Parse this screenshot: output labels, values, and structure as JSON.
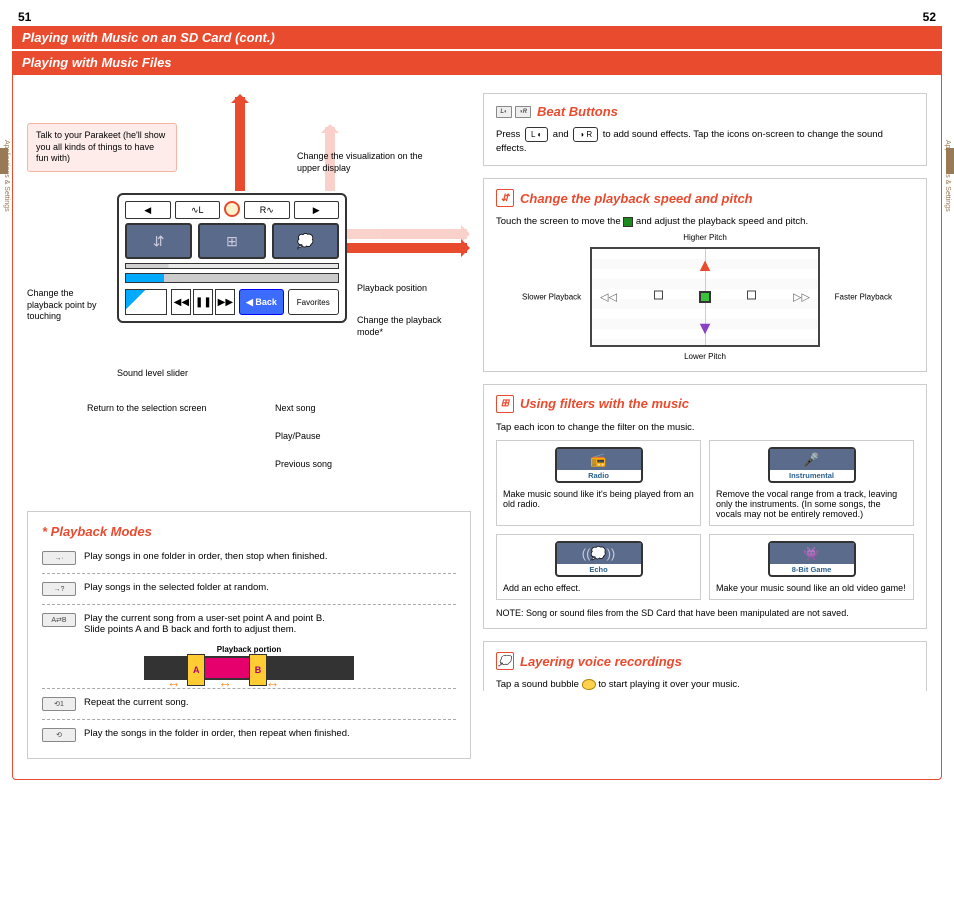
{
  "page_left": "51",
  "page_right": "52",
  "side_tab": "Applications & Settings",
  "header_main": "Playing with Music on an SD Card (cont.)",
  "header_sub": "Playing with Music Files",
  "parakeet_tip": "Talk to your Parakeet (he'll show you all kinds of things to have fun with)",
  "callouts": {
    "change_viz": "Change the visualization on the upper display",
    "playback_pos": "Playback position",
    "change_mode": "Change the playback mode*",
    "change_point": "Change the playback point by touching",
    "sound_slider": "Sound level slider",
    "return_sel": "Return to the selection screen",
    "next": "Next song",
    "playpause": "Play/Pause",
    "prev": "Previous song"
  },
  "device": {
    "l_btn": "L",
    "r_btn": "R",
    "back": "◀ Back",
    "favorites": "Favorites"
  },
  "playback_modes": {
    "title": "* Playback Modes",
    "m1": "Play songs in one folder in order, then stop when finished.",
    "m2": "Play songs in the selected folder at random.",
    "m3a": "Play the current song from a user-set point A and point B.",
    "m3b": "Slide points A and B back and forth to adjust them.",
    "portion_label": "Playback portion",
    "markA": "A",
    "markB": "B",
    "m4": "Repeat the current song.",
    "m5": "Play the songs in the folder in order, then repeat when finished."
  },
  "beat": {
    "title": "Beat Buttons",
    "body1": "Press",
    "key_l": "L ◐",
    "body2": "and",
    "key_r": "◑ R",
    "body3": "to add sound effects. Tap the icons on-screen to change the sound effects."
  },
  "speed": {
    "title": "Change the playback speed and pitch",
    "body": "Touch the screen to move the",
    "body2": "and adjust the playback speed and pitch.",
    "higher": "Higher Pitch",
    "lower": "Lower Pitch",
    "slower": "Slower Playback",
    "faster": "Faster Playback"
  },
  "filters": {
    "title": "Using filters with the music",
    "body": "Tap each icon to change the filter on the music.",
    "radio": {
      "label": "Radio",
      "desc": "Make music sound like it's being played from an old radio."
    },
    "instrumental": {
      "label": "Instrumental",
      "desc": "Remove the vocal range from a track, leaving only the instruments. (In some songs, the vocals may not be entirely removed.)"
    },
    "echo": {
      "label": "Echo",
      "desc": "Add an echo effect."
    },
    "game": {
      "label": "8-Bit Game",
      "desc": "Make your music sound like an old video game!"
    },
    "note": "NOTE: Song or sound files from the SD Card that have been manipulated are not saved."
  },
  "layer": {
    "title": "Layering voice recordings",
    "body1": "Tap a sound bubble",
    "body2": "to start playing it over your music."
  }
}
